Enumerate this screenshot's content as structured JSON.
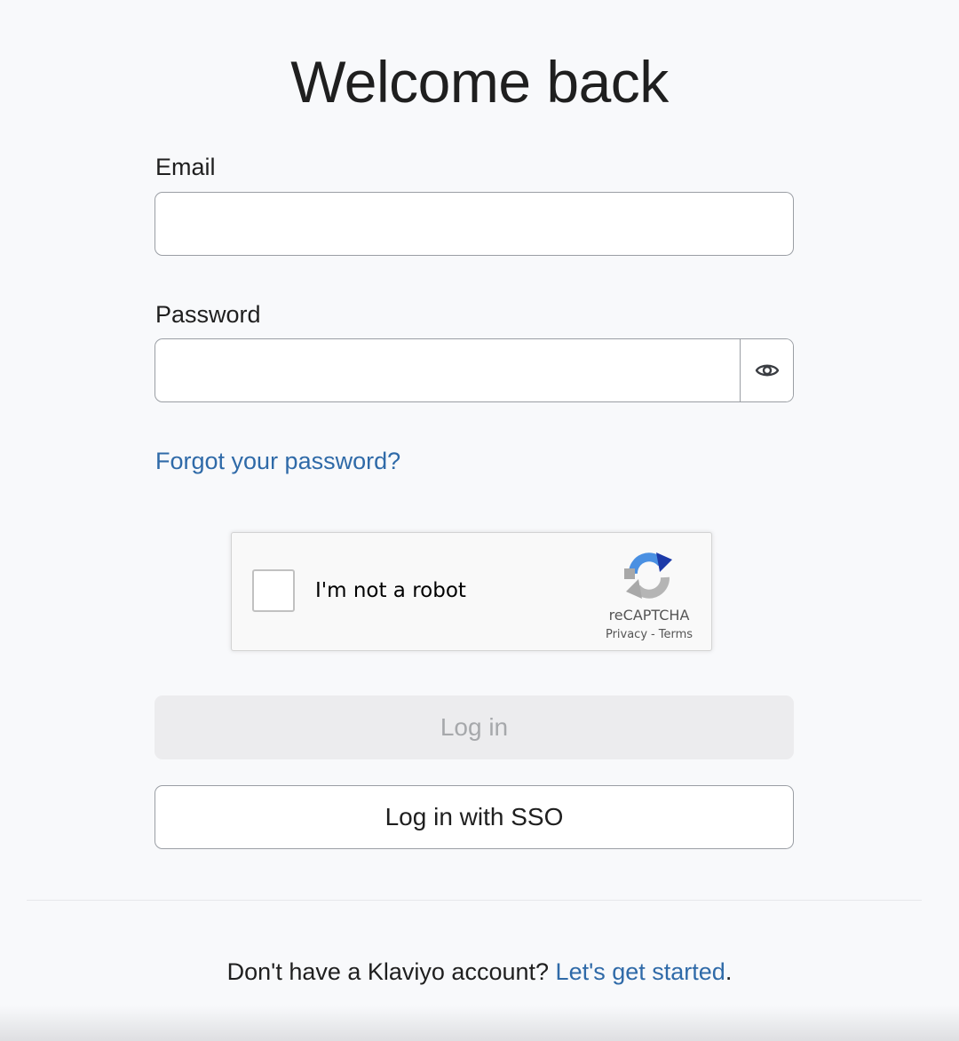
{
  "page": {
    "title": "Welcome back"
  },
  "form": {
    "email_label": "Email",
    "email_value": "",
    "password_label": "Password",
    "password_value": "",
    "show_password_icon": "eye-icon",
    "forgot_password": "Forgot your password?"
  },
  "recaptcha": {
    "label": "I'm not a robot",
    "checked": false,
    "brand": "reCAPTCHA",
    "privacy": "Privacy",
    "separator": "-",
    "terms": "Terms"
  },
  "buttons": {
    "login": "Log in",
    "login_disabled": true,
    "sso": "Log in with SSO"
  },
  "footer": {
    "prompt": "Don't have a Klaviyo account?",
    "link": "Let's get started",
    "end": "."
  },
  "colors": {
    "link": "#2f6aa8",
    "background": "#f8f9fb",
    "disabled_button": "#ececee"
  }
}
